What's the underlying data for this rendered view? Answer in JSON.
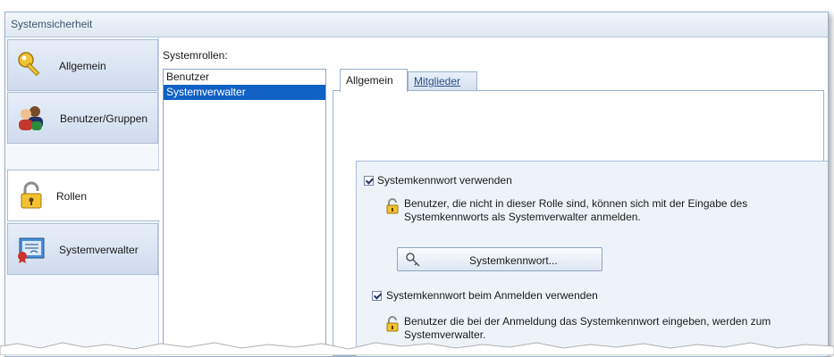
{
  "window": {
    "title": "Systemsicherheit"
  },
  "nav": {
    "items": [
      {
        "label": "Allgemein",
        "icon": "key-icon"
      },
      {
        "label": "Benutzer/Gruppen",
        "icon": "users-icon"
      },
      {
        "label": "Rollen",
        "icon": "padlock-icon"
      },
      {
        "label": "Systemverwalter",
        "icon": "certificate-icon"
      }
    ],
    "selected": "Rollen"
  },
  "roles": {
    "label": "Systemrollen:",
    "items": [
      "Benutzer",
      "Systemverwalter"
    ],
    "selected": "Systemverwalter"
  },
  "tabs": {
    "items": [
      "Allgemein",
      "Mitglieder"
    ],
    "active": "Allgemein"
  },
  "general": {
    "use_password": {
      "label": "Systemkennwort verwenden",
      "checked": true
    },
    "use_password_info": [
      "Benutzer, die nicht in dieser Rolle sind, können sich mit der Eingabe des",
      "Systemkennworts als Systemverwalter anmelden."
    ],
    "password_button": "Systemkennwort...",
    "use_on_login": {
      "label": "Systemkennwort beim Anmelden verwenden",
      "checked": true
    },
    "use_on_login_info": [
      "Benutzer die bei der Anmeldung das Systemkennwort eingeben, werden zum",
      "Systemverwalter."
    ]
  },
  "colors": {
    "selection": "#1160c4",
    "accent_border": "#9ab0cc",
    "group_bg": "#eef3fa"
  }
}
